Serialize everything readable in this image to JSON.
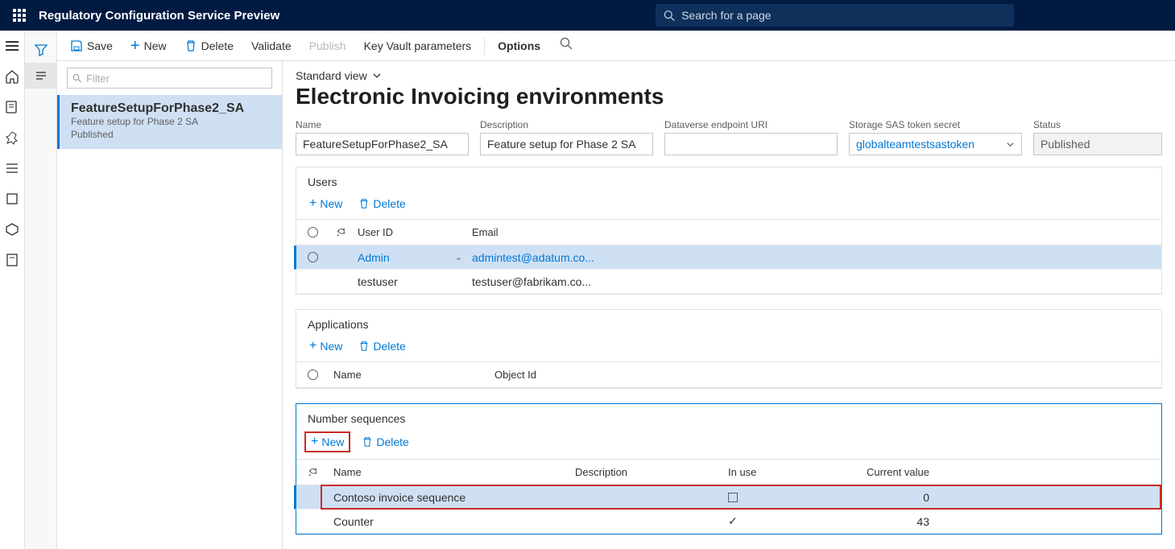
{
  "header": {
    "appTitle": "Regulatory Configuration Service Preview",
    "searchPlaceholder": "Search for a page"
  },
  "cmd": {
    "save": "Save",
    "new": "New",
    "delete": "Delete",
    "validate": "Validate",
    "publish": "Publish",
    "keyvault": "Key Vault parameters",
    "options": "Options"
  },
  "list": {
    "filterPlaceholder": "Filter",
    "item": {
      "title": "FeatureSetupForPhase2_SA",
      "line1": "Feature setup for Phase 2 SA",
      "line2": "Published"
    }
  },
  "main": {
    "viewName": "Standard view",
    "pageTitle": "Electronic Invoicing environments",
    "fields": {
      "name": {
        "label": "Name",
        "value": "FeatureSetupForPhase2_SA"
      },
      "desc": {
        "label": "Description",
        "value": "Feature setup for Phase 2 SA"
      },
      "dvuri": {
        "label": "Dataverse endpoint URI",
        "value": ""
      },
      "sas": {
        "label": "Storage SAS token secret",
        "value": "globalteamtestsastoken"
      },
      "status": {
        "label": "Status",
        "value": "Published"
      }
    }
  },
  "sections": {
    "users": {
      "title": "Users",
      "cols": {
        "uid": "User ID",
        "email": "Email"
      },
      "rows": [
        {
          "uid": "Admin",
          "email": "admintest@adatum.co...",
          "selected": true
        },
        {
          "uid": "testuser",
          "email": "testuser@fabrikam.co...",
          "selected": false
        }
      ]
    },
    "apps": {
      "title": "Applications",
      "cols": {
        "name": "Name",
        "obj": "Object Id"
      }
    },
    "numseq": {
      "title": "Number sequences",
      "cols": {
        "name": "Name",
        "desc": "Description",
        "inuse": "In use",
        "cval": "Current value"
      },
      "rows": [
        {
          "name": "Contoso invoice sequence",
          "desc": "",
          "inuse": false,
          "cval": "0",
          "selected": true,
          "boxed": true
        },
        {
          "name": "Counter",
          "desc": "",
          "inuse": true,
          "cval": "43",
          "selected": false
        }
      ]
    },
    "btnNew": "New",
    "btnDelete": "Delete"
  }
}
